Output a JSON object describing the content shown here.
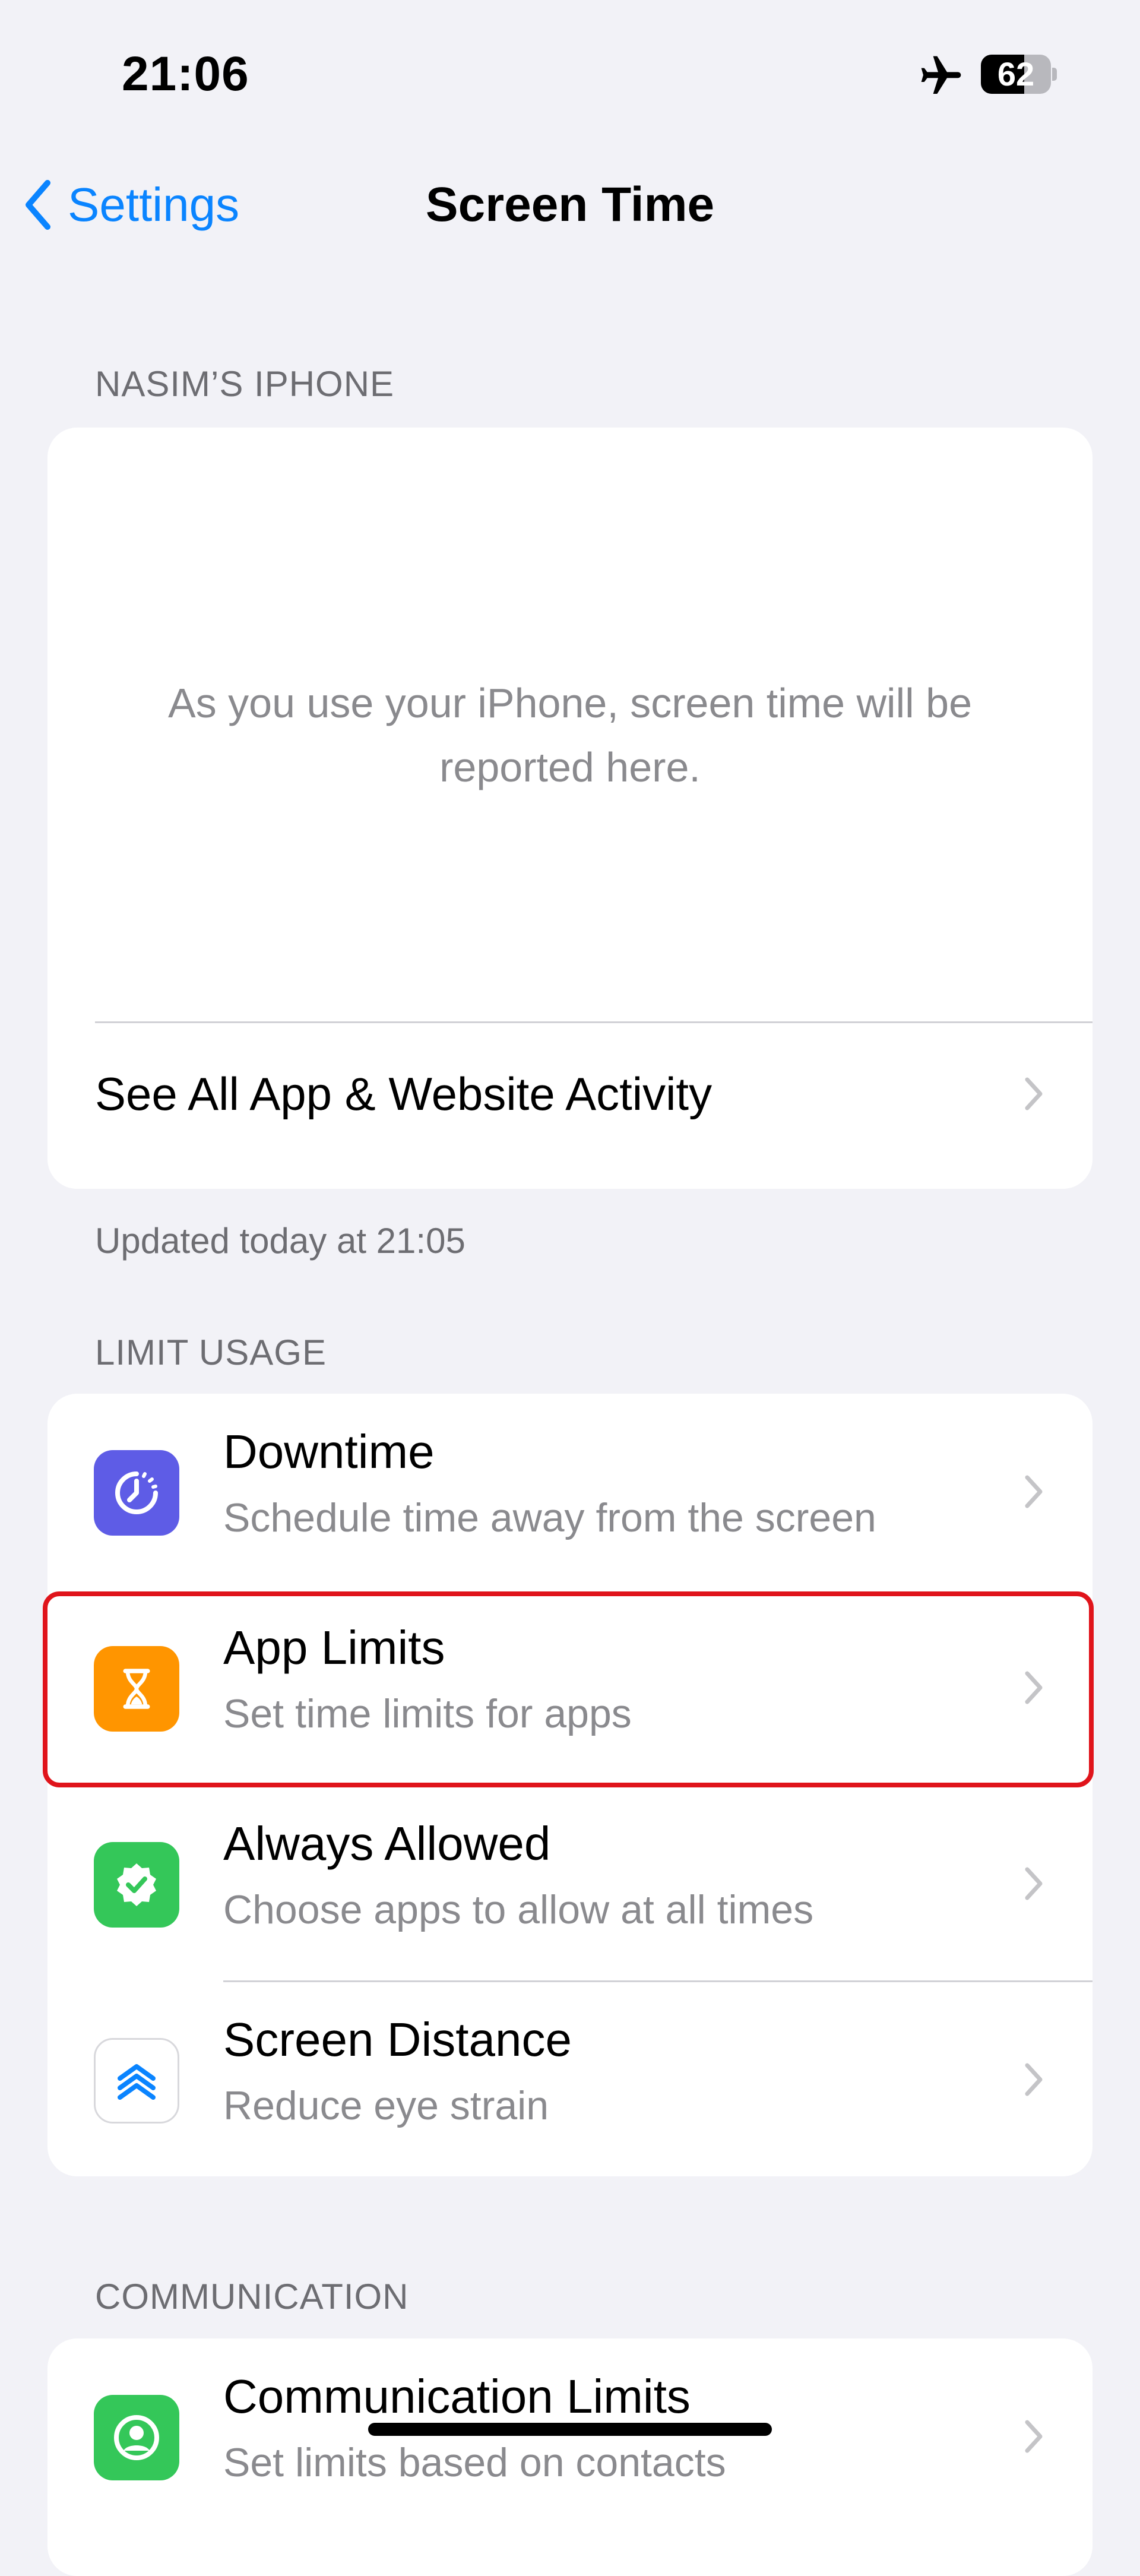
{
  "status_bar": {
    "time": "21:06",
    "battery": "62",
    "battery_level_percent": 62
  },
  "nav": {
    "back_label": "Settings",
    "title": "Screen Time"
  },
  "device_section": {
    "header": "NASIM’S IPHONE",
    "empty_message": "As you use your iPhone, screen time will be reported here.",
    "activity_row_label": "See All App & Website Activity",
    "footer": "Updated today at 21:05"
  },
  "limit_usage": {
    "header": "LIMIT USAGE",
    "items": [
      {
        "title": "Downtime",
        "subtitle": "Schedule time away from the screen",
        "icon": "downtime-icon",
        "color": "#5e5ce6"
      },
      {
        "title": "App Limits",
        "subtitle": "Set time limits for apps",
        "icon": "hourglass-icon",
        "color": "#ff9500"
      },
      {
        "title": "Always Allowed",
        "subtitle": "Choose apps to allow at all times",
        "icon": "checkmark-badge-icon",
        "color": "#34c759"
      },
      {
        "title": "Screen Distance",
        "subtitle": "Reduce eye strain",
        "icon": "chevrons-up-icon",
        "color": "#ffffff"
      }
    ]
  },
  "communication": {
    "header": "COMMUNICATION",
    "items": [
      {
        "title": "Communication Limits",
        "subtitle": "Set limits based on contacts",
        "icon": "person-circle-icon",
        "color": "#34c759"
      }
    ]
  },
  "colors": {
    "accent": "#0a84ff",
    "highlight": "#e0141b"
  }
}
